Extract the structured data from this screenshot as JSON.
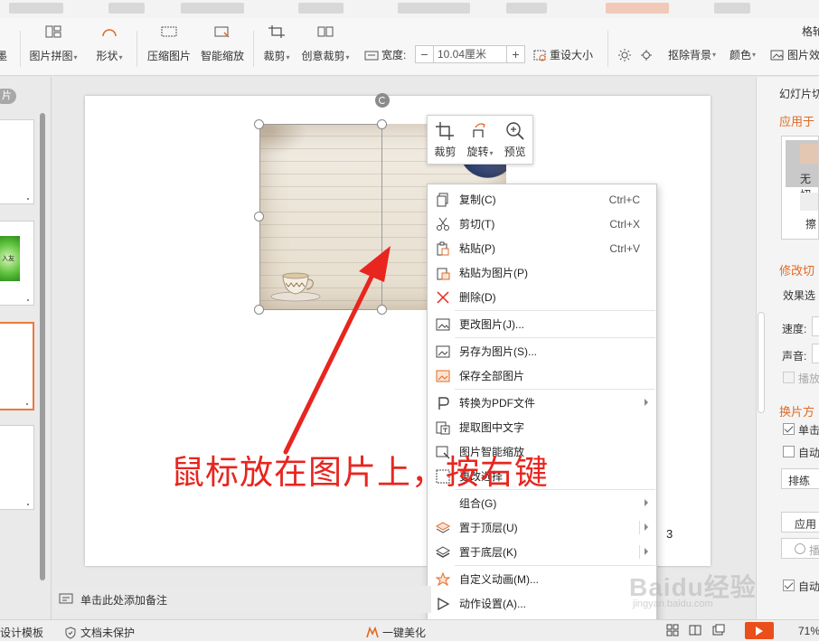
{
  "ribbon": {
    "picture_collage": "图片拼图",
    "shape": "形状",
    "compress": "压缩图片",
    "smart_scale": "智能缩放",
    "crop": "裁剪",
    "creative_crop": "创意裁剪",
    "width_label": "宽度:",
    "width_value": "10.04厘米",
    "minus": "−",
    "plus": "+",
    "reset_size": "重设大小",
    "remove_bg": "抠除背景",
    "color": "颜色",
    "pic_effect": "图片效",
    "left_clip": "墨",
    "right_clip": "格轮"
  },
  "thumbs": {
    "tab": "片",
    "thumb2_text": "入友"
  },
  "mini_toolbar": {
    "crop": "裁剪",
    "rotate": "旋转",
    "preview": "预览"
  },
  "context_menu": {
    "items": [
      {
        "label": "复制(C)",
        "key": "Ctrl+C",
        "icon": "copy-icon"
      },
      {
        "label": "剪切(T)",
        "key": "Ctrl+X",
        "icon": "scissors-icon"
      },
      {
        "label": "粘贴(P)",
        "key": "Ctrl+V",
        "icon": "paste-icon"
      },
      {
        "label": "粘贴为图片(P)",
        "key": "",
        "icon": "paste-picture-icon"
      },
      {
        "label": "删除(D)",
        "key": "",
        "icon": "delete-icon"
      },
      {
        "label": "更改图片(J)...",
        "key": "",
        "icon": "change-picture-icon"
      },
      {
        "label": "另存为图片(S)...",
        "key": "",
        "icon": "save-picture-icon"
      },
      {
        "label": "保存全部图片",
        "key": "",
        "icon": "save-all-pictures-icon"
      },
      {
        "label": "转换为PDF文件",
        "key": "",
        "icon": "pdf-icon"
      },
      {
        "label": "提取图中文字",
        "key": "",
        "icon": "extract-text-icon"
      },
      {
        "label": "图片智能缩放",
        "key": "",
        "icon": "smart-scale-icon"
      },
      {
        "label": "更改选择",
        "key": "",
        "icon": "change-selection-icon"
      },
      {
        "label": "组合(G)",
        "key": "",
        "icon": ""
      },
      {
        "label": "置于顶层(U)",
        "key": "",
        "icon": "bring-to-front-icon"
      },
      {
        "label": "置于底层(K)",
        "key": "",
        "icon": "send-to-back-icon"
      },
      {
        "label": "自定义动画(M)...",
        "key": "",
        "icon": "custom-animation-icon"
      },
      {
        "label": "动作设置(A)...",
        "key": "",
        "icon": "action-settings-icon"
      }
    ]
  },
  "annotation": "鼠标放在图片上，按右键",
  "slide_number": "3",
  "notes_placeholder": "单击此处添加备注",
  "right_panel": {
    "title": "幻灯片切",
    "apply_to": "应用于",
    "none": "无切",
    "erase": "擦",
    "modify": "修改切",
    "effect_options": "效果选",
    "speed": "速度:",
    "sound": "声音:",
    "play": "播放",
    "switch_mode": "换片方",
    "on_click": "单击",
    "auto": "自动",
    "rehearse": "排练当",
    "apply_all": "应用",
    "play_btn": "播",
    "auto2": "自动"
  },
  "status_bar": {
    "design_template": "设计模板",
    "doc_protect": "文档未保护",
    "one_click": "一键美化",
    "zoom": "71%"
  },
  "watermark": {
    "brand": "Baidu经验",
    "url": "jingyan.baidu.com"
  },
  "colors": {
    "accent_orange": "#e06a24",
    "annotation_red": "#e8251f",
    "play_button": "#e94e1b"
  }
}
